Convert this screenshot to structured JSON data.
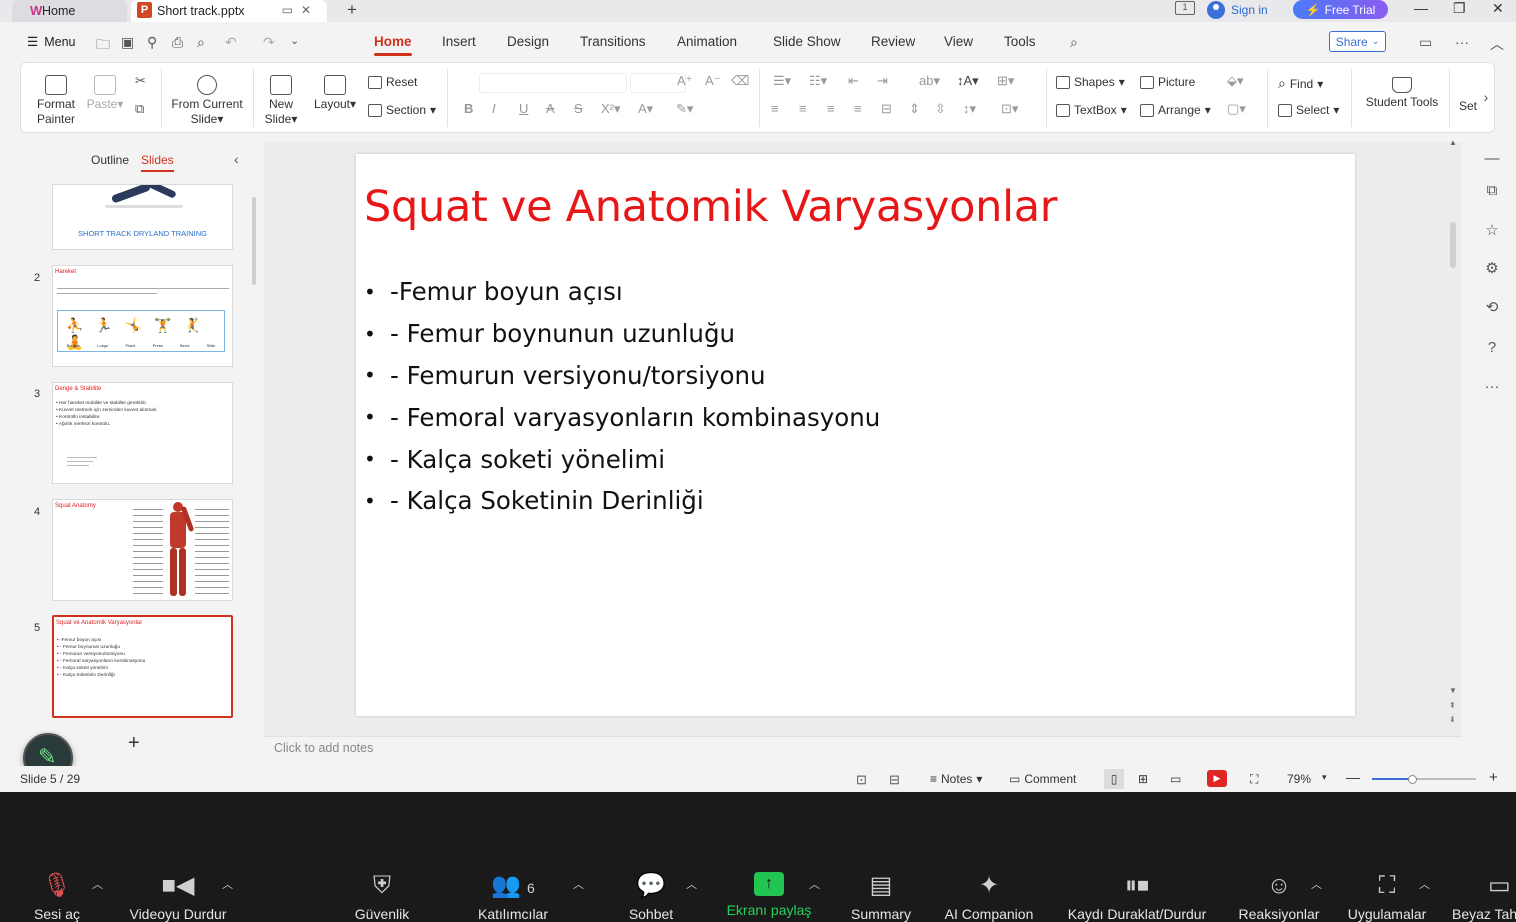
{
  "titlebar": {
    "home_tab": "Home",
    "doc_tab": "Short track.pptx",
    "sign_in": "Sign in",
    "free_trial": "Free Trial"
  },
  "menubar": {
    "menu": "Menu",
    "tabs": [
      "Home",
      "Insert",
      "Design",
      "Transitions",
      "Animation",
      "Slide Show",
      "Review",
      "View",
      "Tools"
    ],
    "active_tab": "Home",
    "share": "Share"
  },
  "ribbon": {
    "format_painter_1": "Format",
    "format_painter_2": "Painter",
    "paste": "Paste",
    "from_current_1": "From Current",
    "from_current_2": "Slide",
    "new_slide_1": "New",
    "new_slide_2": "Slide",
    "layout": "Layout",
    "reset": "Reset",
    "section": "Section",
    "shapes": "Shapes",
    "picture": "Picture",
    "textbox": "TextBox",
    "arrange": "Arrange",
    "find": "Find",
    "select": "Select",
    "student_tools": "Student Tools",
    "settings_partial": "Set"
  },
  "panel": {
    "outline_tab": "Outline",
    "slides_tab": "Slides",
    "thumbs": [
      {
        "num": "",
        "caption": "SHORT TRACK DRYLAND TRAINING"
      },
      {
        "num": "2",
        "title": "Hareket",
        "caption_rows": [
          "Bounce",
          "Lunge",
          "Plank",
          "Press",
          "Bend",
          "Slide"
        ]
      },
      {
        "num": "3",
        "title": "Denge & Stabilite",
        "text": "• Her hareket mobilite ve stabilite gerektirir.\n• Kuvvet üretmek için zeminden kuvvet alınmalı.\n• Kontrollü instabilite.\n• Ağırlık merkezi kontrolü."
      },
      {
        "num": "4",
        "title": "Squat Anatomy"
      },
      {
        "num": "5",
        "title": "Squat ve Anatomik Varyasyonlar",
        "text": "• -Femur boyun açısı\n• - Femur boynunun uzunluğu\n• - Femurun versiyonu/torsiyonu\n• - Femoral varyasyonların kombinasyonu\n• - Kalça soketi yönelimi\n• - Kalça Soketinin Derinliği"
      }
    ]
  },
  "slide": {
    "title": "Squat ve Anatomik Varyasyonlar",
    "bullets": [
      "-Femur boyun açısı",
      "- Femur boynunun uzunluğu",
      "- Femurun versiyonu/torsiyonu",
      "- Femoral varyasyonların kombinasyonu",
      "- Kalça soketi yönelimi",
      "- Kalça Soketinin Derinliği"
    ],
    "title_color": "#e81717"
  },
  "notes_placeholder": "Click to add notes",
  "status": {
    "slide_counter": "Slide 5 / 29",
    "notes": "Notes",
    "comment": "Comment",
    "zoom": "79%"
  },
  "zoom_bar": {
    "badge_participants": "6",
    "buttons": [
      "Sesi aç",
      "Videoyu Durdur",
      "Güvenlik",
      "Katılımcılar",
      "Sohbet",
      "Ekranı paylaş",
      "Summary",
      "AI Companion",
      "Kaydı Duraklat/Durdur",
      "Reaksiyonlar",
      "Uygulamalar",
      "Beyaz Tahta"
    ]
  },
  "accent_color": "#d0321e",
  "share_green": "#22d35a"
}
